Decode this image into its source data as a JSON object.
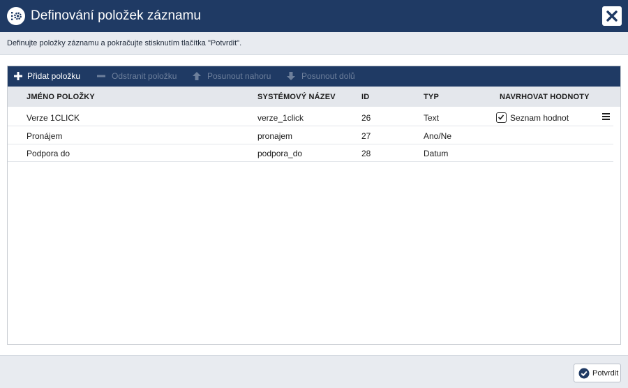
{
  "dialog": {
    "title": "Definování položek záznamu",
    "instruction": "Definujte položky záznamu a pokračujte stisknutím tlačítka \"Potvrdit\"."
  },
  "toolbar": {
    "add": "Přidat položku",
    "remove": "Odstranit položku",
    "move_up": "Posunout nahoru",
    "move_down": "Posunout dolů"
  },
  "table": {
    "headers": {
      "name": "JMÉNO POLOŽKY",
      "system_name": "SYSTÉMOVÝ NÁZEV",
      "id": "ID",
      "type": "TYP",
      "suggest": "NAVRHOVAT HODNOTY"
    },
    "rows": [
      {
        "name": "Verze 1CLICK",
        "system_name": "verze_1click",
        "id": "26",
        "type": "Text",
        "suggest_label": "Seznam hodnot",
        "suggest_checked": true
      },
      {
        "name": "Pronájem",
        "system_name": "pronajem",
        "id": "27",
        "type": "Ano/Ne"
      },
      {
        "name": "Podpora do",
        "system_name": "podpora_do",
        "id": "28",
        "type": "Datum"
      }
    ]
  },
  "footer": {
    "confirm": "Potvrdit"
  },
  "colors": {
    "header_bg": "#1f3a64",
    "toolbar_disabled_text": "#6d7f9b"
  },
  "icons": {
    "title": "record-settings-icon",
    "close": "close-icon",
    "add": "plus-icon",
    "remove": "minus-icon",
    "up": "arrow-up-icon",
    "down": "arrow-down-icon",
    "row_menu": "hamburger-menu-icon",
    "confirm": "check-circle-icon"
  }
}
